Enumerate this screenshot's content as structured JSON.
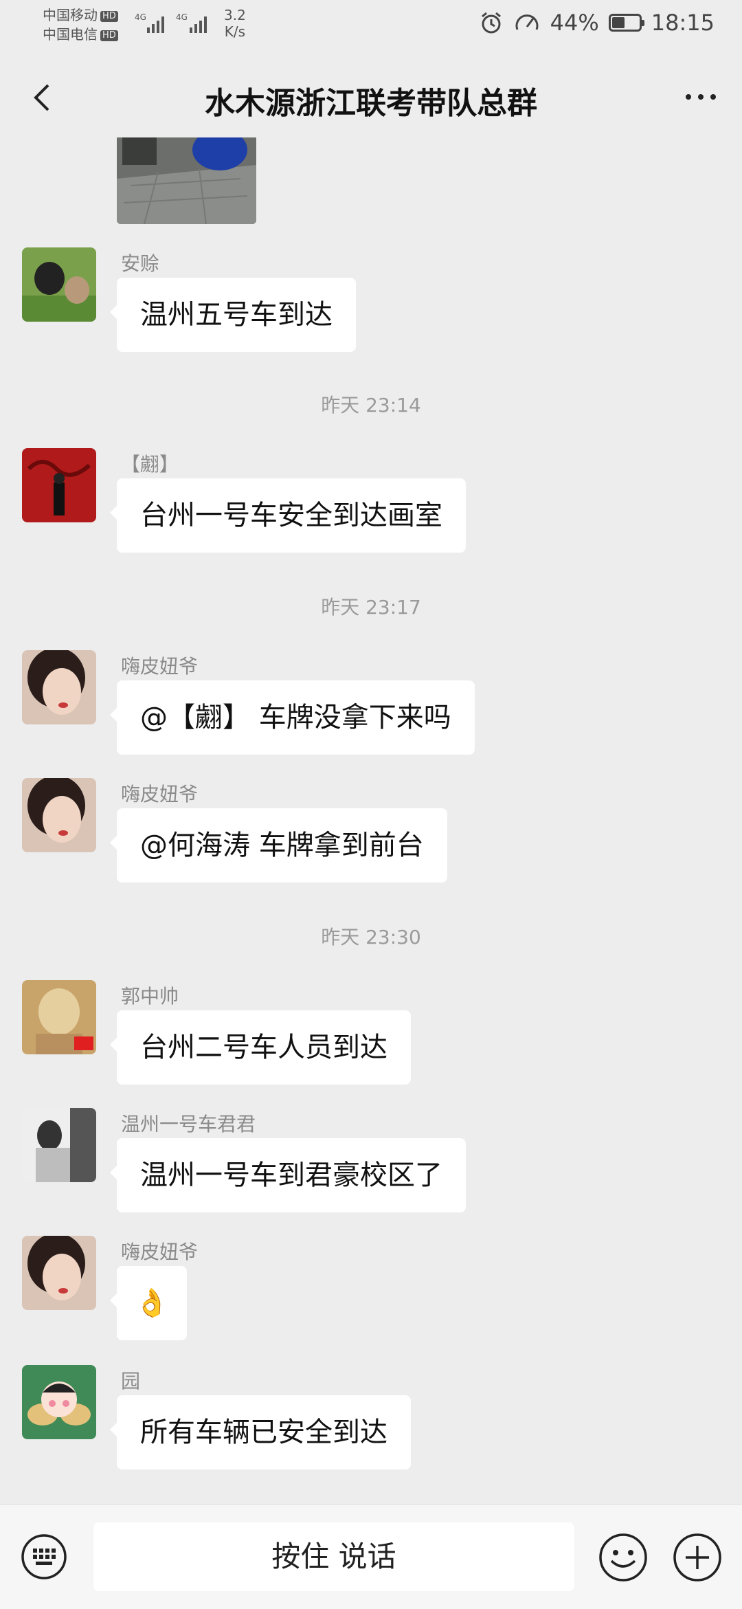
{
  "status_bar": {
    "carrier1": "中国移动",
    "carrier2": "中国电信",
    "hd": "HD",
    "net1": "4G",
    "net2": "4G",
    "speed_value": "3.2",
    "speed_unit": "K/s",
    "battery": "44%",
    "time": "18:15"
  },
  "header": {
    "title": "水木源浙江联考带队总群"
  },
  "timestamps": [
    "昨天 23:14",
    "昨天 23:17",
    "昨天 23:30"
  ],
  "messages": [
    {
      "sender": "安赊",
      "text": "温州五号车到达"
    },
    {
      "sender": "【翽】",
      "text": "台州一号车安全到达画室"
    },
    {
      "sender": "嗨皮妞爷",
      "text": "@【翽】  车牌没拿下来吗"
    },
    {
      "sender": "嗨皮妞爷",
      "text": "@何海涛  车牌拿到前台"
    },
    {
      "sender": "郭中帅",
      "text": "台州二号车人员到达"
    },
    {
      "sender": "温州一号车君君",
      "text": "温州一号车到君豪校区了"
    },
    {
      "sender": "嗨皮妞爷",
      "text": "👌"
    },
    {
      "sender": "园",
      "text": "所有车辆已安全到达"
    }
  ],
  "input_bar": {
    "voice_label": "按住 说话"
  },
  "icons": {
    "back": "back-arrow-icon",
    "more": "more-icon",
    "keyboard": "keyboard-icon",
    "emoji": "emoji-icon",
    "plus": "plus-icon"
  }
}
